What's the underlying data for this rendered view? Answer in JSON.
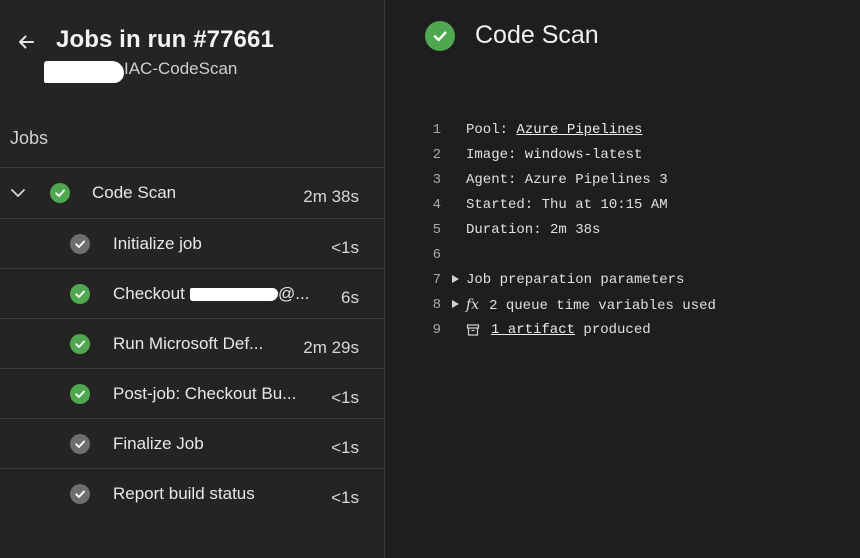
{
  "header": {
    "title": "Jobs in run #77661",
    "subtitle": "IAC-CodeScan"
  },
  "jobs_label": "Jobs",
  "parent_job": {
    "name": "Code Scan",
    "duration": "2m 38s",
    "status": "succeeded"
  },
  "steps": [
    {
      "name": "Initialize job",
      "duration": "<1s",
      "status": "skipped"
    },
    {
      "name": "Checkout",
      "name_suffix": "@...",
      "duration": "6s",
      "status": "succeeded"
    },
    {
      "name": "Run Microsoft Def...",
      "duration": "2m 29s",
      "status": "succeeded"
    },
    {
      "name": "Post-job: Checkout Bu...",
      "duration": "<1s",
      "status": "succeeded"
    },
    {
      "name": "Finalize Job",
      "duration": "<1s",
      "status": "skipped"
    },
    {
      "name": "Report build status",
      "duration": "<1s",
      "status": "skipped"
    }
  ],
  "main": {
    "title": "Code Scan",
    "log": [
      {
        "n": "1",
        "prefix": "Pool: ",
        "link": "Azure Pipelines"
      },
      {
        "n": "2",
        "text": "Image: windows-latest"
      },
      {
        "n": "3",
        "text": "Agent: Azure Pipelines 3"
      },
      {
        "n": "4",
        "text": "Started: Thu at 10:15 AM"
      },
      {
        "n": "5",
        "text": "Duration: 2m 38s"
      },
      {
        "n": "6",
        "text": ""
      },
      {
        "n": "7",
        "text": "Job preparation parameters"
      },
      {
        "n": "8",
        "fx": "fx",
        "text": "2 queue time variables used"
      },
      {
        "n": "9",
        "link": "1 artifact",
        "suffix": " produced"
      }
    ]
  },
  "colors": {
    "success": "#4fa84f",
    "skipped": "#6e6e6e",
    "background": "#1e1e1e",
    "sidebar": "#252423"
  },
  "icons": [
    "back-arrow-icon",
    "chevron-down-icon",
    "check-icon",
    "expand-triangle-icon",
    "fx-icon",
    "artifact-box-icon"
  ]
}
